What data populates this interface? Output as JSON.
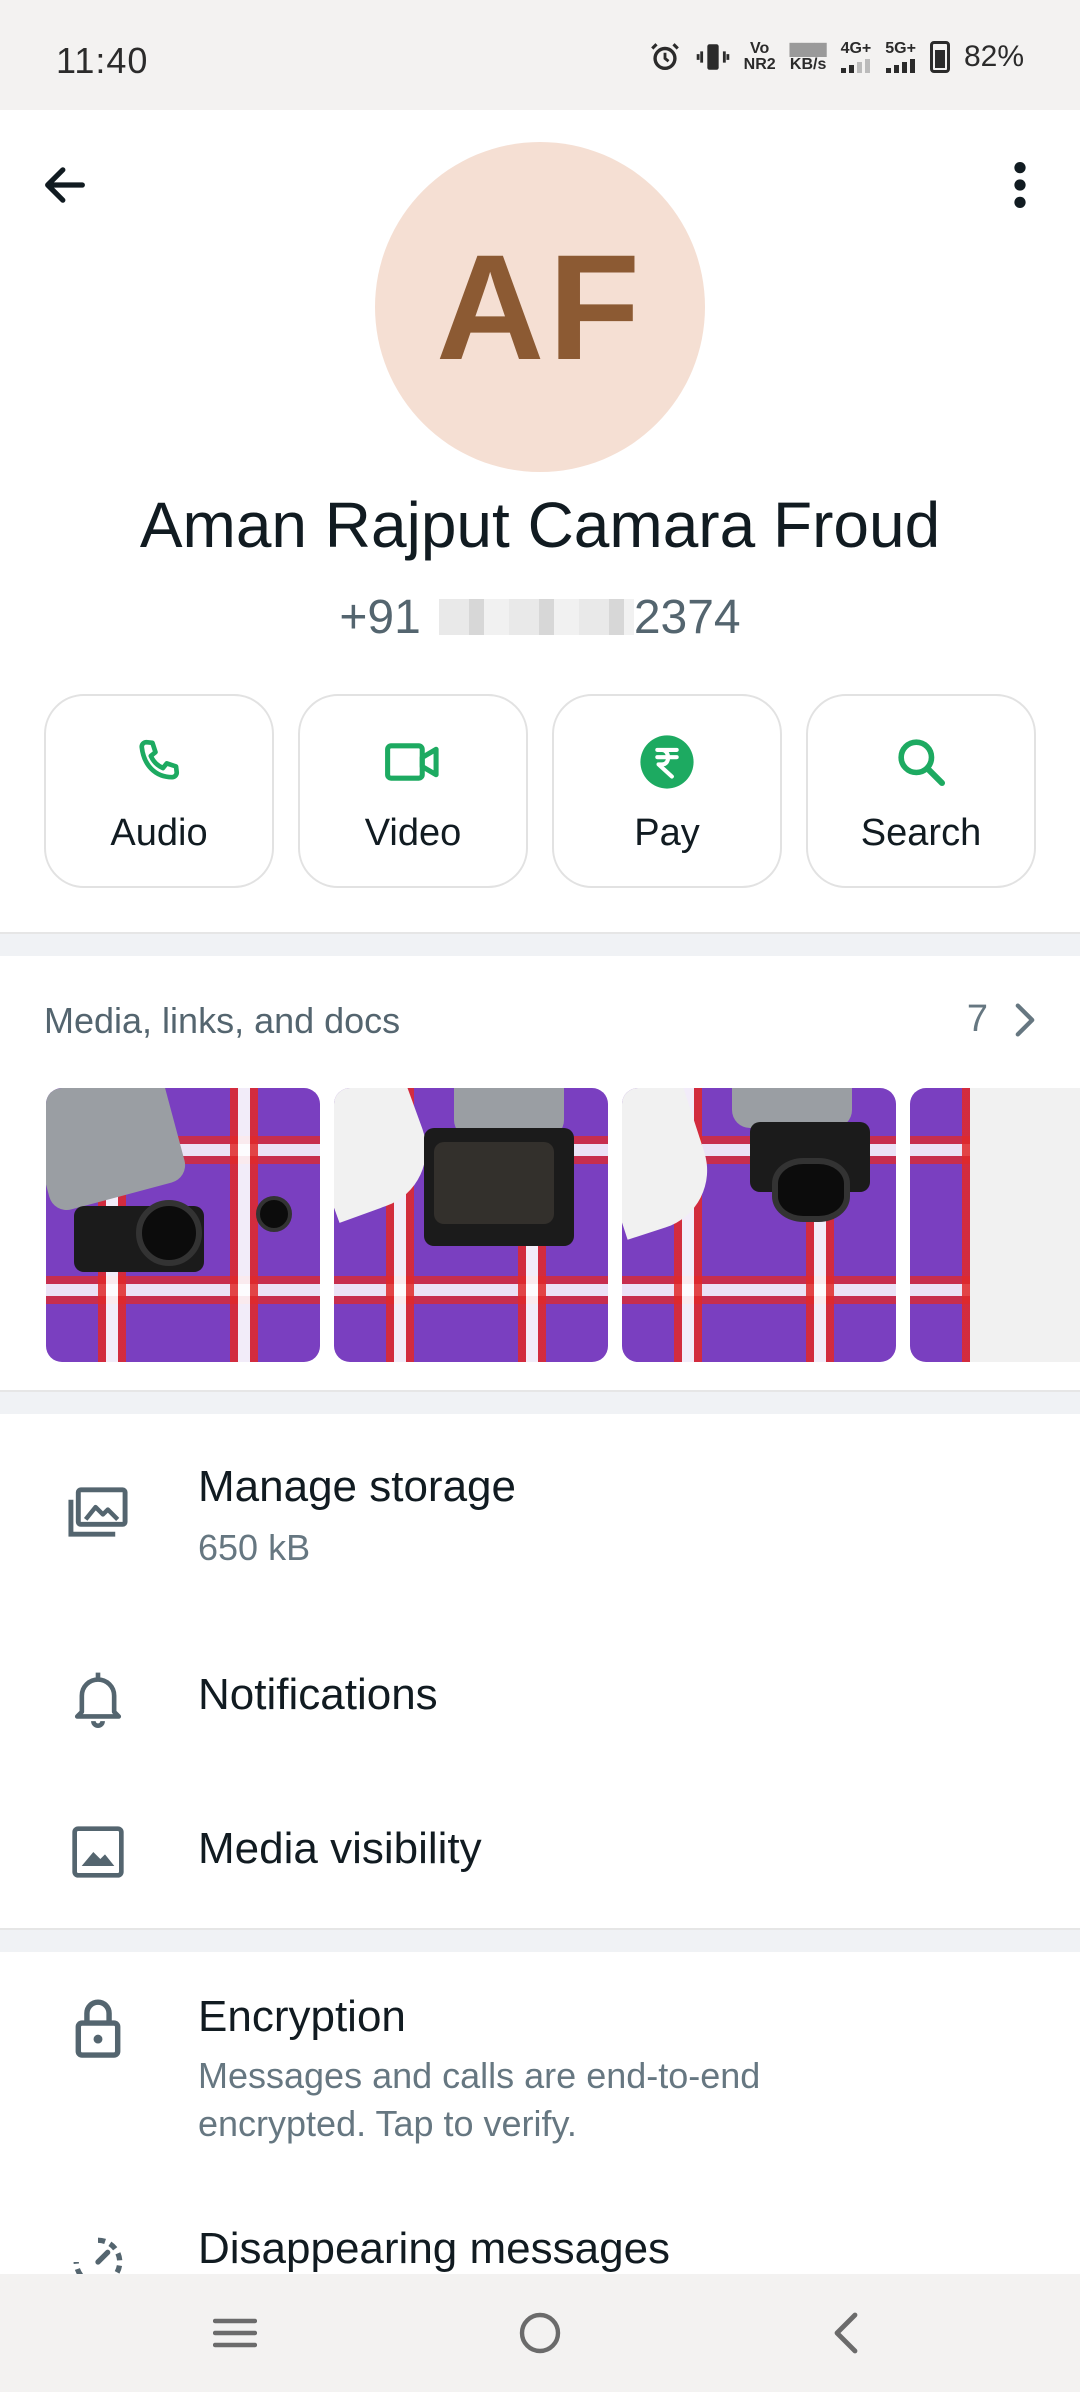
{
  "status_bar": {
    "time": "11:40",
    "vo_label": "Vo",
    "nr_label": "NR2",
    "speed_label": "KB/s",
    "net1_label": "4G+",
    "net2_label": "5G+",
    "battery": "82%"
  },
  "contact": {
    "initials": "AF",
    "name": "Aman Rajput Camara Froud",
    "phone_prefix": "+91",
    "phone_suffix": "2374",
    "avatar_bg": "#f5dfd3",
    "avatar_fg": "#8c5a33"
  },
  "actions": [
    {
      "label": "Audio",
      "icon": "phone-icon"
    },
    {
      "label": "Video",
      "icon": "video-camera-icon"
    },
    {
      "label": "Pay",
      "icon": "rupee-icon"
    },
    {
      "label": "Search",
      "icon": "search-icon"
    }
  ],
  "accent_color": "#1daa61",
  "media": {
    "title": "Media, links, and docs",
    "count": "7"
  },
  "settings": {
    "manage_storage": {
      "title": "Manage storage",
      "subtitle": "650 kB"
    },
    "notifications": {
      "title": "Notifications"
    },
    "media_visibility": {
      "title": "Media visibility"
    },
    "encryption": {
      "title": "Encryption",
      "subtitle": "Messages and calls are end-to-end encrypted. Tap to verify."
    },
    "disappearing": {
      "title": "Disappearing messages"
    }
  }
}
